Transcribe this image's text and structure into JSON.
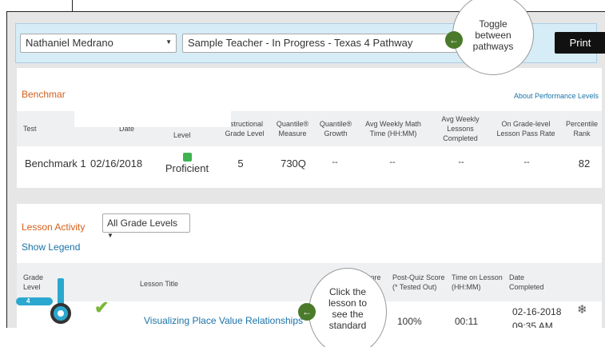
{
  "toolbar": {
    "student": "Nathaniel Medrano",
    "pathway": "Sample Teacher - In Progress - Texas 4 Pathway",
    "print": "Print"
  },
  "benchmark": {
    "title": "Benchmar",
    "about_link": "About Performance Levels",
    "headers": {
      "test": "Test",
      "date": "Date",
      "level": "Level",
      "instr_l1": "nstructional",
      "instr_l2": "Grade Level",
      "quantile_l1": "Quantile®",
      "quantile_l2": "Measure",
      "growth_l1": "Quantile®",
      "growth_l2": "Growth",
      "math_l1": "Avg Weekly Math",
      "math_l2": "Time (HH:MM)",
      "lessons_l1": "Avg Weekly",
      "lessons_l2": "Lessons",
      "lessons_l3": "Completed",
      "pass_l1": "On Grade-level",
      "pass_l2": "Lesson Pass Rate",
      "rank_l1": "Percentile",
      "rank_l2": "Rank"
    },
    "row": {
      "test": "Benchmark 1",
      "date": "02/16/2018",
      "level": "Proficient",
      "instr": "5",
      "quantile": "730Q",
      "growth": "--",
      "math_time": "--",
      "lessons": "--",
      "pass_rate": "--",
      "rank": "82"
    },
    "level_color": "#3fb34f"
  },
  "lesson_activity": {
    "title": "Lesson Activity",
    "grade_filter": "All Grade Levels",
    "legend_link": "Show Legend",
    "headers": {
      "grade_l1": "Grade",
      "grade_l2": "Level",
      "lesson_title": "Lesson Title",
      "pre_quiz": "Pre-Quiz Score",
      "post_l1": "Post-Quiz Score",
      "post_l2": "(* Tested Out)",
      "time_l1": "Time on Lesson",
      "time_l2": "(HH:MM)",
      "date_l1": "Date",
      "date_l2": "Completed"
    },
    "row": {
      "grade": "4",
      "lesson_title": "Visualizing Place Value Relationships",
      "post_quiz": "100%",
      "time": "00:11",
      "date_l1": "02-16-2018",
      "date_l2": "09:35 AM"
    }
  },
  "callouts": {
    "toggle": [
      "Toggle",
      "between",
      "pathways"
    ],
    "lesson": [
      "Click the",
      "lesson to",
      "see the",
      "standard"
    ]
  },
  "icons": {
    "arrow": "←",
    "check": "✔",
    "award": "❄"
  }
}
